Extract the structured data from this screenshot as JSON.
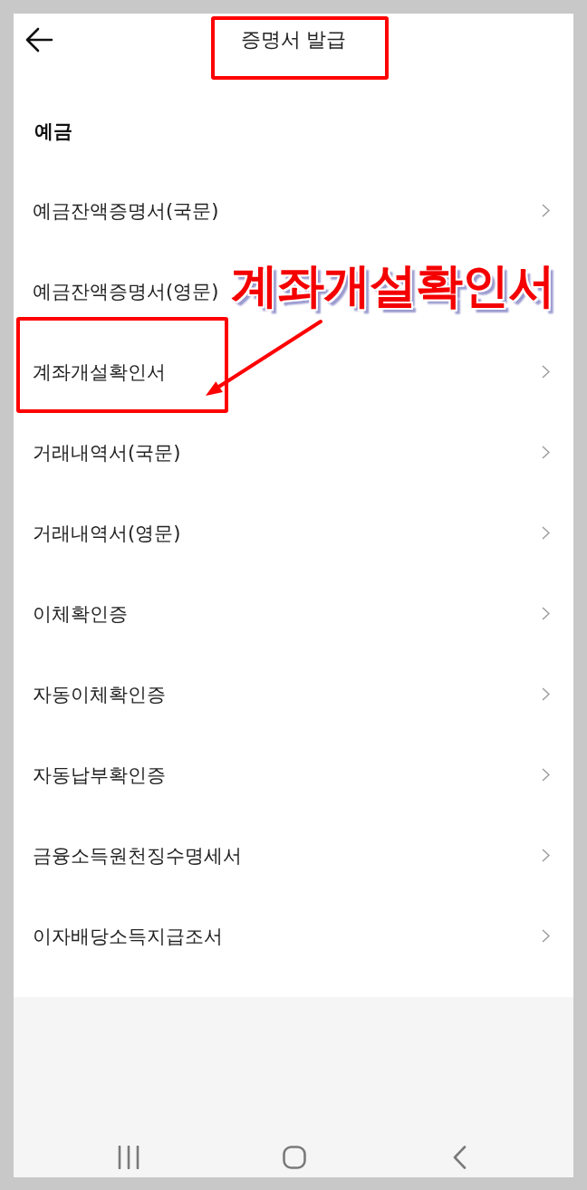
{
  "header": {
    "title": "증명서 발급",
    "highlighted": true
  },
  "section": {
    "title": "예금"
  },
  "items": [
    {
      "label": "예금잔액증명서(국문)",
      "chevron": true,
      "highlighted": false
    },
    {
      "label": "예금잔액증명서(영문)",
      "chevron": false,
      "highlighted": false
    },
    {
      "label": "계좌개설확인서",
      "chevron": true,
      "highlighted": true
    },
    {
      "label": "거래내역서(국문)",
      "chevron": true,
      "highlighted": false
    },
    {
      "label": "거래내역서(영문)",
      "chevron": true,
      "highlighted": false
    },
    {
      "label": "이체확인증",
      "chevron": true,
      "highlighted": false
    },
    {
      "label": "자동이체확인증",
      "chevron": true,
      "highlighted": false
    },
    {
      "label": "자동납부확인증",
      "chevron": true,
      "highlighted": false
    },
    {
      "label": "금융소득원천징수명세서",
      "chevron": true,
      "highlighted": false
    },
    {
      "label": "이자배당소득지급조서",
      "chevron": true,
      "highlighted": false
    }
  ],
  "callout": {
    "text": "계좌개설확인서"
  }
}
